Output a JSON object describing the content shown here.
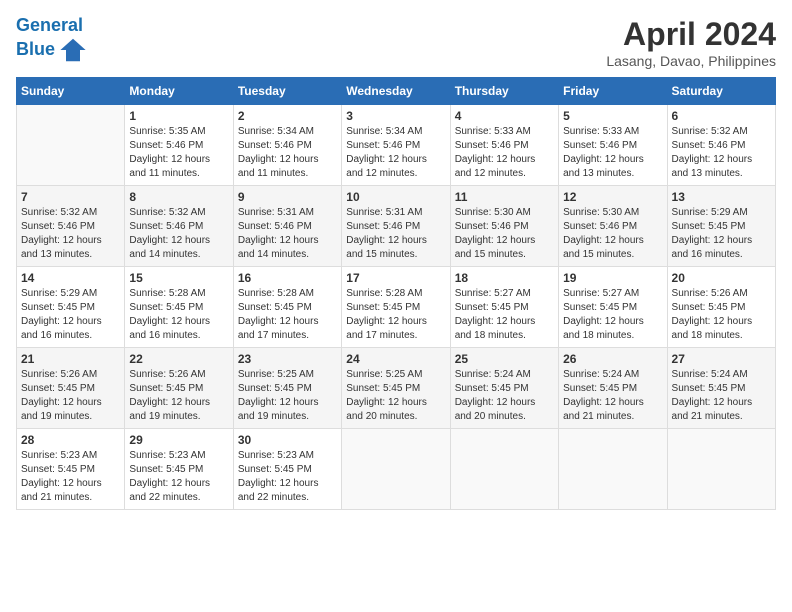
{
  "header": {
    "logo_line1": "General",
    "logo_line2": "Blue",
    "month_title": "April 2024",
    "location": "Lasang, Davao, Philippines"
  },
  "weekdays": [
    "Sunday",
    "Monday",
    "Tuesday",
    "Wednesday",
    "Thursday",
    "Friday",
    "Saturday"
  ],
  "weeks": [
    [
      {
        "day": "",
        "empty": true
      },
      {
        "day": "1",
        "sunrise": "5:35 AM",
        "sunset": "5:46 PM",
        "daylight": "12 hours and 11 minutes."
      },
      {
        "day": "2",
        "sunrise": "5:34 AM",
        "sunset": "5:46 PM",
        "daylight": "12 hours and 11 minutes."
      },
      {
        "day": "3",
        "sunrise": "5:34 AM",
        "sunset": "5:46 PM",
        "daylight": "12 hours and 12 minutes."
      },
      {
        "day": "4",
        "sunrise": "5:33 AM",
        "sunset": "5:46 PM",
        "daylight": "12 hours and 12 minutes."
      },
      {
        "day": "5",
        "sunrise": "5:33 AM",
        "sunset": "5:46 PM",
        "daylight": "12 hours and 13 minutes."
      },
      {
        "day": "6",
        "sunrise": "5:32 AM",
        "sunset": "5:46 PM",
        "daylight": "12 hours and 13 minutes."
      }
    ],
    [
      {
        "day": "7",
        "sunrise": "5:32 AM",
        "sunset": "5:46 PM",
        "daylight": "12 hours and 13 minutes."
      },
      {
        "day": "8",
        "sunrise": "5:32 AM",
        "sunset": "5:46 PM",
        "daylight": "12 hours and 14 minutes."
      },
      {
        "day": "9",
        "sunrise": "5:31 AM",
        "sunset": "5:46 PM",
        "daylight": "12 hours and 14 minutes."
      },
      {
        "day": "10",
        "sunrise": "5:31 AM",
        "sunset": "5:46 PM",
        "daylight": "12 hours and 15 minutes."
      },
      {
        "day": "11",
        "sunrise": "5:30 AM",
        "sunset": "5:46 PM",
        "daylight": "12 hours and 15 minutes."
      },
      {
        "day": "12",
        "sunrise": "5:30 AM",
        "sunset": "5:46 PM",
        "daylight": "12 hours and 15 minutes."
      },
      {
        "day": "13",
        "sunrise": "5:29 AM",
        "sunset": "5:45 PM",
        "daylight": "12 hours and 16 minutes."
      }
    ],
    [
      {
        "day": "14",
        "sunrise": "5:29 AM",
        "sunset": "5:45 PM",
        "daylight": "12 hours and 16 minutes."
      },
      {
        "day": "15",
        "sunrise": "5:28 AM",
        "sunset": "5:45 PM",
        "daylight": "12 hours and 16 minutes."
      },
      {
        "day": "16",
        "sunrise": "5:28 AM",
        "sunset": "5:45 PM",
        "daylight": "12 hours and 17 minutes."
      },
      {
        "day": "17",
        "sunrise": "5:28 AM",
        "sunset": "5:45 PM",
        "daylight": "12 hours and 17 minutes."
      },
      {
        "day": "18",
        "sunrise": "5:27 AM",
        "sunset": "5:45 PM",
        "daylight": "12 hours and 18 minutes."
      },
      {
        "day": "19",
        "sunrise": "5:27 AM",
        "sunset": "5:45 PM",
        "daylight": "12 hours and 18 minutes."
      },
      {
        "day": "20",
        "sunrise": "5:26 AM",
        "sunset": "5:45 PM",
        "daylight": "12 hours and 18 minutes."
      }
    ],
    [
      {
        "day": "21",
        "sunrise": "5:26 AM",
        "sunset": "5:45 PM",
        "daylight": "12 hours and 19 minutes."
      },
      {
        "day": "22",
        "sunrise": "5:26 AM",
        "sunset": "5:45 PM",
        "daylight": "12 hours and 19 minutes."
      },
      {
        "day": "23",
        "sunrise": "5:25 AM",
        "sunset": "5:45 PM",
        "daylight": "12 hours and 19 minutes."
      },
      {
        "day": "24",
        "sunrise": "5:25 AM",
        "sunset": "5:45 PM",
        "daylight": "12 hours and 20 minutes."
      },
      {
        "day": "25",
        "sunrise": "5:24 AM",
        "sunset": "5:45 PM",
        "daylight": "12 hours and 20 minutes."
      },
      {
        "day": "26",
        "sunrise": "5:24 AM",
        "sunset": "5:45 PM",
        "daylight": "12 hours and 21 minutes."
      },
      {
        "day": "27",
        "sunrise": "5:24 AM",
        "sunset": "5:45 PM",
        "daylight": "12 hours and 21 minutes."
      }
    ],
    [
      {
        "day": "28",
        "sunrise": "5:23 AM",
        "sunset": "5:45 PM",
        "daylight": "12 hours and 21 minutes."
      },
      {
        "day": "29",
        "sunrise": "5:23 AM",
        "sunset": "5:45 PM",
        "daylight": "12 hours and 22 minutes."
      },
      {
        "day": "30",
        "sunrise": "5:23 AM",
        "sunset": "5:45 PM",
        "daylight": "12 hours and 22 minutes."
      },
      {
        "day": "",
        "empty": true
      },
      {
        "day": "",
        "empty": true
      },
      {
        "day": "",
        "empty": true
      },
      {
        "day": "",
        "empty": true
      }
    ]
  ],
  "labels": {
    "sunrise": "Sunrise:",
    "sunset": "Sunset:",
    "daylight": "Daylight:"
  }
}
